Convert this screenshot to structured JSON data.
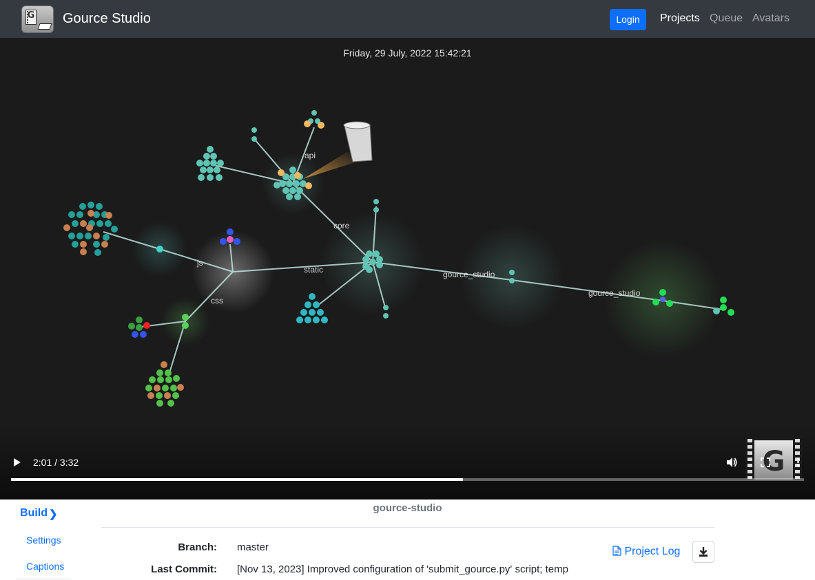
{
  "navbar": {
    "brand_title": "Gource Studio",
    "login_label": "Login",
    "links": [
      {
        "label": "Projects",
        "active": true
      },
      {
        "label": "Queue",
        "active": false
      },
      {
        "label": "Avatars",
        "active": false
      }
    ]
  },
  "video": {
    "date_caption": "Friday, 29 July, 2022 15:42:21",
    "time_display": "2:01 / 3:32",
    "progress_fraction": 0.57,
    "node_labels": [
      "api",
      "core",
      "js",
      "static",
      "css",
      "gource_studio",
      "gource_studio"
    ]
  },
  "sidebar": {
    "build_label": "Build",
    "settings_label": "Settings",
    "captions_label": "Captions"
  },
  "details": {
    "project_name": "gource-studio",
    "branch_label": "Branch:",
    "branch_value": "master",
    "last_commit_label": "Last Commit:",
    "last_commit_value": "[Nov 13, 2023] Improved configuration of 'submit_gource.py' script; temp",
    "project_log_label": "Project Log"
  },
  "colors": {
    "navbar_bg": "#343a40",
    "accent": "#0d6efd",
    "video_bg": "#1b1b1b"
  }
}
